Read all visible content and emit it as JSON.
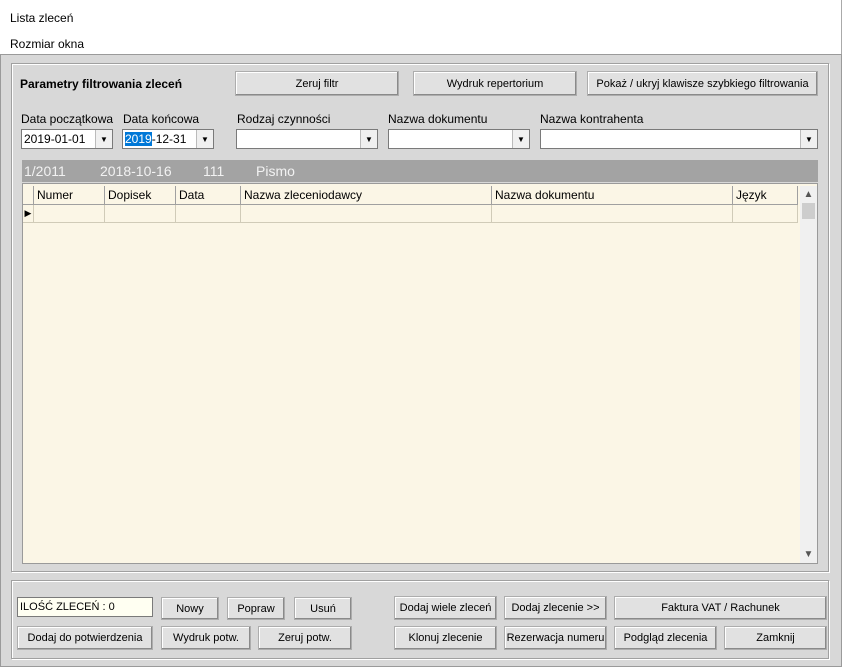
{
  "menu": {
    "item1": "Lista zleceń",
    "item2": "Rozmiar okna"
  },
  "filter": {
    "title": "Parametry filtrowania zleceń",
    "reset_filter": "Zeruj filtr",
    "print_repertory": "Wydruk repertorium",
    "toggle_quick_filter": "Pokaż / ukryj klawisze szybkiego filtrowania",
    "labels": {
      "start_date": "Data początkowa",
      "end_date": "Data końcowa",
      "activity_type": "Rodzaj czynności",
      "document_name": "Nazwa dokumentu",
      "contractor_name": "Nazwa kontrahenta"
    },
    "start_date_value": "2019-01-01",
    "end_date_year_selected": "2019",
    "end_date_rest": "-12-31",
    "activity_type_value": "",
    "document_name_value": "",
    "contractor_name_value": ""
  },
  "grid": {
    "group_header": {
      "c1": "1/2011",
      "c2": "2018-10-16",
      "c3": "111",
      "c4": "Pismo"
    },
    "columns": [
      "Numer",
      "Dopisek",
      "Data",
      "Nazwa zleceniodawcy",
      "Nazwa dokumentu",
      "Język"
    ]
  },
  "footer": {
    "count_label": "ILOŚĆ ZLECEŃ : 0",
    "new": "Nowy",
    "edit": "Popraw",
    "delete": "Usuń",
    "add_many": "Dodaj wiele zleceń",
    "add_order": "Dodaj zlecenie >>",
    "invoice": "Faktura VAT / Rachunek",
    "add_confirmation": "Dodaj do potwierdzenia",
    "print_confirmation": "Wydruk potw.",
    "reset_confirmation": "Zeruj potw.",
    "clone_order": "Klonuj zlecenie",
    "reserve_number": "Rezerwacja numeru",
    "preview_order": "Podgląd zlecenia",
    "close": "Zamknij"
  }
}
